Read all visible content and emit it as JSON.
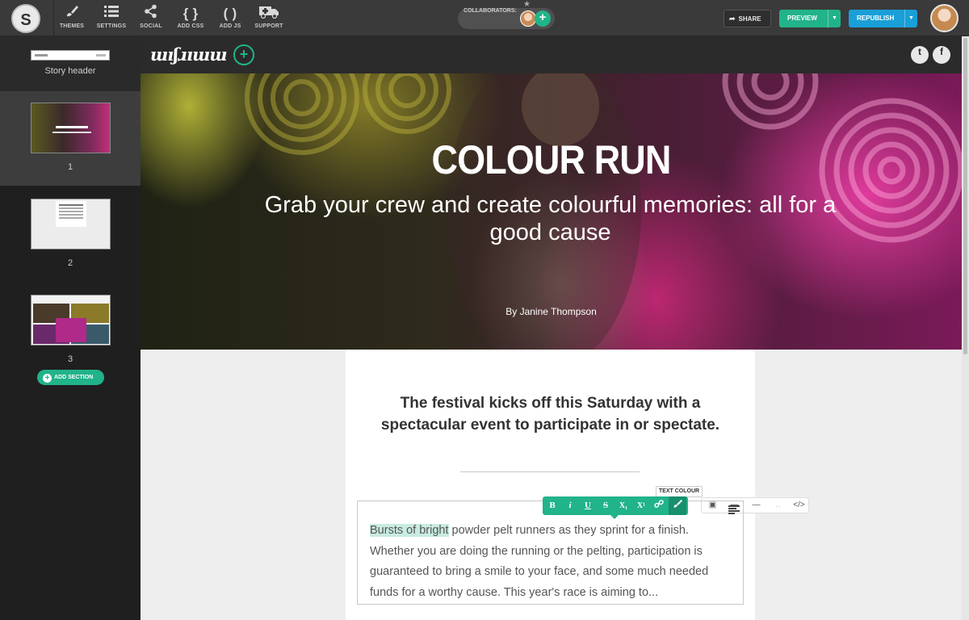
{
  "toolbar": {
    "logo": "S",
    "items": [
      {
        "label": "THEMES",
        "icon": "brush-icon"
      },
      {
        "label": "SETTINGS",
        "icon": "settings-list-icon"
      },
      {
        "label": "SOCIAL",
        "icon": "share-nodes-icon"
      },
      {
        "label": "ADD CSS",
        "icon": "css-braces-icon"
      },
      {
        "label": "ADD JS",
        "icon": "js-parens-icon"
      },
      {
        "label": "SUPPORT",
        "icon": "ambulance-icon"
      }
    ],
    "collaborators_label": "COLLABORATORS:",
    "share_label": "SHARE",
    "preview_label": "PREVIEW",
    "republish_label": "REPUBLISH"
  },
  "sidebar": {
    "header_label": "Story header",
    "sections": [
      {
        "number": "1",
        "active": true
      },
      {
        "number": "2",
        "active": false
      },
      {
        "number": "3",
        "active": false
      }
    ],
    "add_section_label": "ADD SECTION"
  },
  "site": {
    "brand": "ɯıʃɹıɯɯ",
    "social": [
      "twitter-icon",
      "facebook-icon"
    ]
  },
  "hero": {
    "title": "COLOUR RUN",
    "subtitle": "Grab your crew and create colourful memories: all for a good cause",
    "byline": "By Janine Thompson"
  },
  "content": {
    "lead": "The festival kicks off this Saturday with a spectacular event to participate in or spectate.",
    "tooltip": "TEXT COLOUR",
    "format_buttons": [
      "B",
      "i",
      "U",
      "S",
      "X₁",
      "X¹",
      "link",
      "brush"
    ],
    "body_highlight": "Bursts of bright",
    "body_rest": " powder pelt runners as they sprint for a finish. Whether you are doing the running or the pelting, participation is guaranteed to bring a smile to your face, and some much needed funds for a worthy cause. This year's race is aiming to..."
  },
  "colors": {
    "accent": "#21b38a",
    "republish": "#1a9fd8",
    "toolbar_bg": "#3a3a3a",
    "sidebar_bg": "#1f1f1f"
  }
}
